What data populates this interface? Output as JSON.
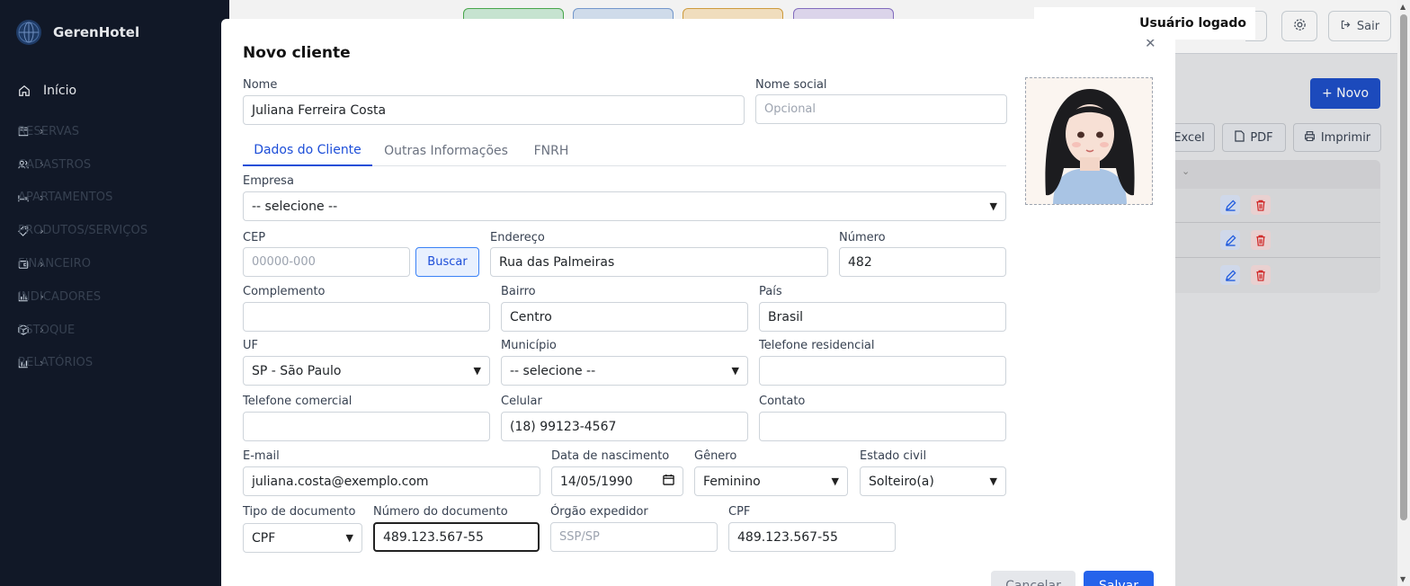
{
  "app": {
    "brand": "GerenHotel",
    "user_label": "Usuário logado",
    "exit_label": "Sair"
  },
  "sidebar": {
    "home": "Início",
    "items": [
      {
        "label": "RESERVAS",
        "icon": "calendar-icon"
      },
      {
        "label": "CADASTROS",
        "icon": "users-icon"
      },
      {
        "label": "APARTAMENTOS",
        "icon": "bed-icon"
      },
      {
        "label": "PRODUTOS/SERVIÇOS",
        "icon": "tag-icon"
      },
      {
        "label": "FINANCEIRO",
        "icon": "wallet-icon"
      },
      {
        "label": "INDICADORES",
        "icon": "bar-chart-icon"
      },
      {
        "label": "ESTOQUE",
        "icon": "box-icon"
      },
      {
        "label": "RELATÓRIOS",
        "icon": "chart-icon"
      }
    ]
  },
  "background": {
    "new_button": "+ Novo",
    "excel_label": "Excel",
    "pdf_label": "PDF",
    "print_label": "Imprimir"
  },
  "modal": {
    "title": "Novo cliente",
    "fields": {
      "nome": {
        "label": "Nome",
        "value": "Juliana Ferreira Costa"
      },
      "nome_social": {
        "label": "Nome social",
        "placeholder": "Opcional"
      },
      "empresa": {
        "label": "Empresa",
        "value": "-- selecione --"
      },
      "cep": {
        "label": "CEP",
        "placeholder": "00000-000"
      },
      "buscar": "Buscar",
      "endereco": {
        "label": "Endereço",
        "value": "Rua das Palmeiras"
      },
      "numero": {
        "label": "Número",
        "value": "482"
      },
      "complemento": {
        "label": "Complemento",
        "value": ""
      },
      "bairro": {
        "label": "Bairro",
        "value": "Centro"
      },
      "pais": {
        "label": "País",
        "value": "Brasil"
      },
      "uf": {
        "label": "UF",
        "value": "SP - São Paulo"
      },
      "municipio": {
        "label": "Município",
        "value": "-- selecione --"
      },
      "tel_residencial": {
        "label": "Telefone residencial",
        "value": ""
      },
      "tel_comercial": {
        "label": "Telefone comercial",
        "value": ""
      },
      "celular": {
        "label": "Celular",
        "value": "(18) 99123-4567"
      },
      "contato": {
        "label": "Contato",
        "value": ""
      },
      "email": {
        "label": "E-mail",
        "value": "juliana.costa@exemplo.com"
      },
      "nascimento": {
        "label": "Data de nascimento",
        "value": "14/05/1990"
      },
      "genero": {
        "label": "Gênero",
        "value": "Feminino"
      },
      "estado_civil": {
        "label": "Estado civil",
        "value": "Solteiro(a)"
      },
      "tipo_doc": {
        "label": "Tipo de documento",
        "value": "CPF"
      },
      "num_doc": {
        "label": "Número do documento",
        "value": "489.123.567-55"
      },
      "orgao": {
        "label": "Órgão expedidor",
        "placeholder": "SSP/SP"
      },
      "cpf": {
        "label": "CPF",
        "value": "489.123.567-55"
      }
    },
    "tabs": [
      "Dados do Cliente",
      "Outras Informações",
      "FNRH"
    ],
    "cancel_label": "Cancelar",
    "save_label": "Salvar"
  },
  "colors": {
    "sidebar_bg": "#111827",
    "accent": "#2563eb",
    "danger": "#dc2626"
  }
}
